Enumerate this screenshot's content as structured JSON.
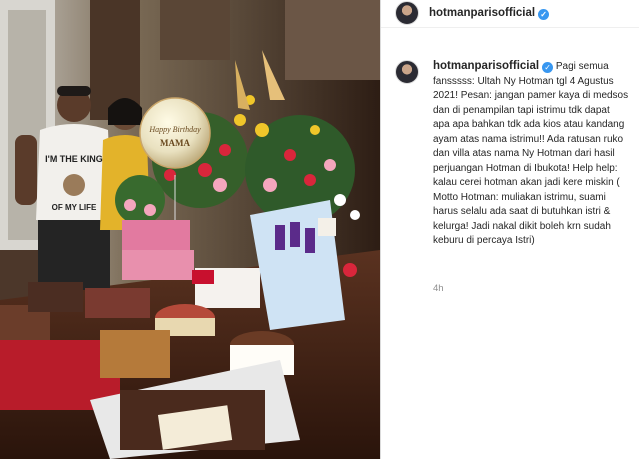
{
  "post": {
    "username": "hotmanparisofficial",
    "verified_icon": "verified-badge-icon",
    "caption": "Pagi semua fansssss: Ultah Ny Hotman tgl 4 Agustus 2021! Pesan: jangan pamer kaya di medsos dan di penampilan tapi istrimu tdk dapat apa apa bahkan tdk ada kios atau kandang ayam atas nama istrimu!! Ada ratusan ruko dan villa atas nama Ny Hotman dari hasil perjuangan Hotman di Ibukota! Help help: kalau cerei hotman akan jadi kere miskin ( Motto Hotman: muliakan istrimu, suami harus selalu ada saat di butuhkan istri & kelurga! Jadi nakal dikit boleh krn sudah keburu di percaya Istri)",
    "timestamp": "4h"
  },
  "photo": {
    "shirt_text": "I'M THE KING OF MY LIFE",
    "balloon_text": "Happy Birthday MAMA"
  },
  "colors": {
    "verified": "#3897f0",
    "text": "#262626",
    "muted": "#8e8e8e",
    "border": "#dbdbdb"
  }
}
